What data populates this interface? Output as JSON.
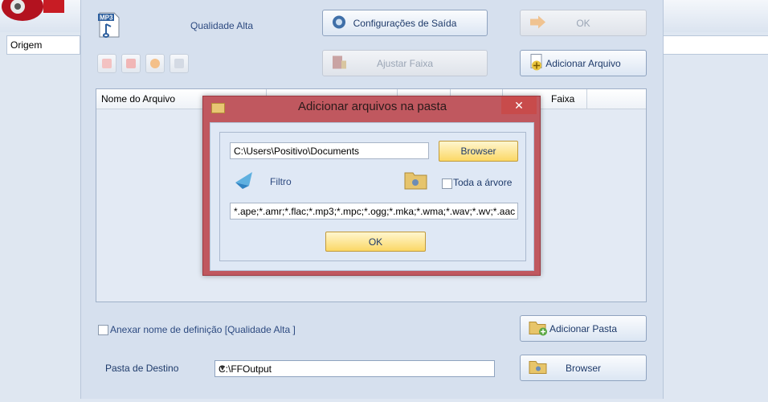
{
  "background": {
    "origem_label": "Origem"
  },
  "main": {
    "quality_label": "Qualidade Alta",
    "output_config_button": "Configurações de Saída",
    "ok_button": "OK",
    "adjust_track_button": "Ajustar Faixa",
    "add_file_button": "Adicionar Arquivo",
    "columns": [
      "Nome do Arquivo",
      "",
      "",
      "",
      "Faixa"
    ],
    "append_name_label": "Anexar nome de definição [Qualidade Alta ]",
    "add_folder_button": "Adicionar Pasta",
    "destination_label": "Pasta de Destino",
    "destination_value": "C:\\FFOutput",
    "browse_button": "Browser",
    "mp3_icon_text": "MP3"
  },
  "modal": {
    "title": "Adicionar arquivos na pasta",
    "close": "✕",
    "path_value": "C:\\Users\\Positivo\\Documents",
    "browse_button": "Browser",
    "filter_label": "Filtro",
    "whole_tree_label": "Toda a árvore",
    "filter_value": "*.ape;*.amr;*.flac;*.mp3;*.mpc;*.ogg;*.mka;*.wma;*.wav;*.wv;*.aac",
    "ok_button": "OK"
  },
  "colors": {
    "modal_frame": "#c0585f",
    "yellow_button": "#fbd866",
    "panel": "#d6e0ee"
  }
}
